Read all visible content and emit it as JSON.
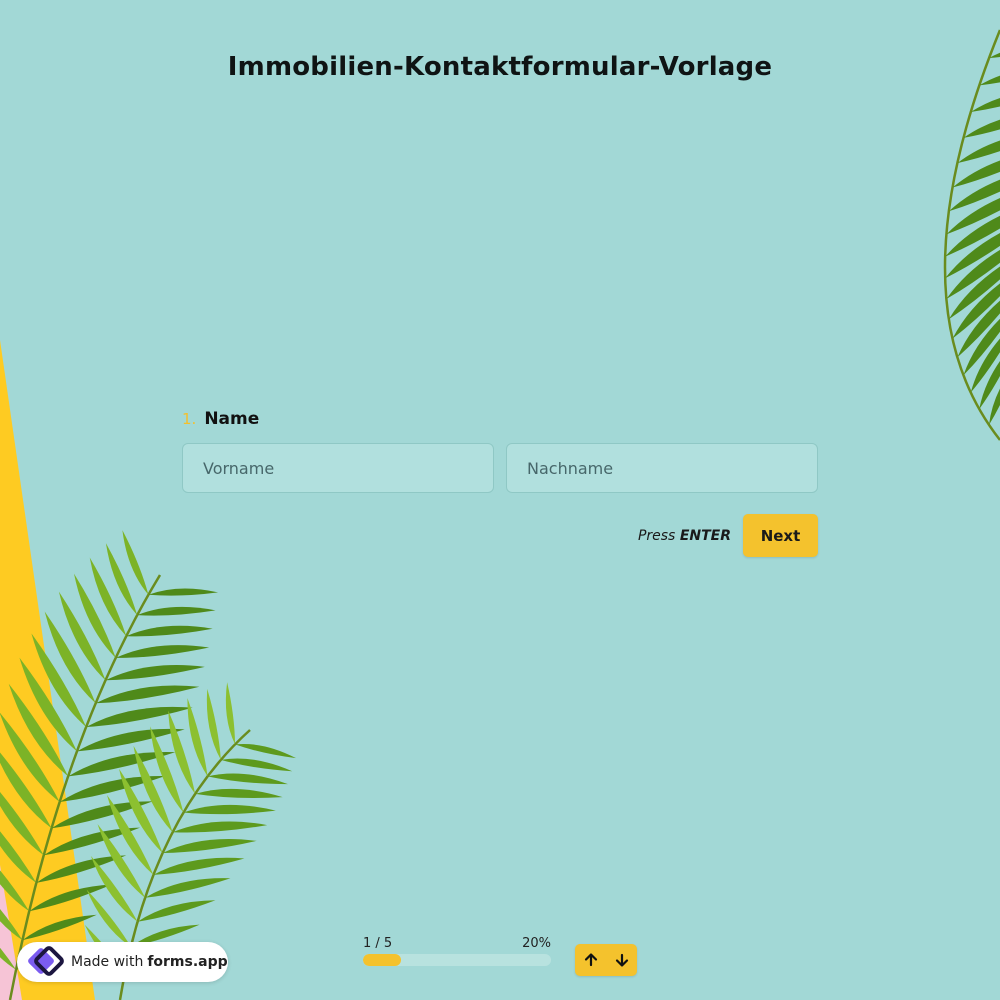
{
  "form": {
    "title": "Immobilien-Kontaktformular-Vorlage",
    "question": {
      "number": "1.",
      "label": "Name",
      "first_name_placeholder": "Vorname",
      "last_name_placeholder": "Nachname"
    },
    "hint": {
      "prefix": "Press",
      "key": "ENTER"
    },
    "next_label": "Next"
  },
  "progress": {
    "step_label": "1 / 5",
    "percent_label": "20%",
    "fraction": 0.2
  },
  "badge": {
    "text": "Made with",
    "brand": "forms.app"
  },
  "colors": {
    "background": "#a2d8d6",
    "accent": "#f4c22d",
    "stripe_yellow": "#fecb22",
    "stripe_pink": "#f6c4d6"
  },
  "icons": {
    "up": "arrow-up-icon",
    "down": "arrow-down-icon",
    "logo": "forms-app-logo-icon",
    "decor": "palm-leaf-icon"
  }
}
